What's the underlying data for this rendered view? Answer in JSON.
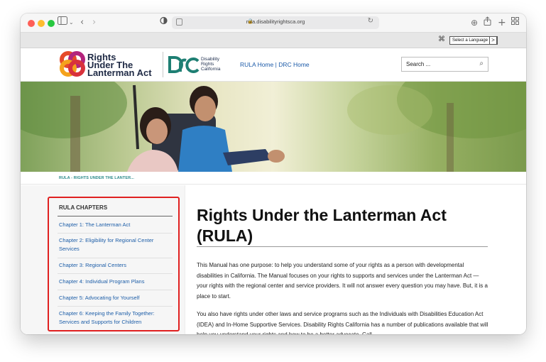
{
  "browser": {
    "url": "rula.disabilityrightsca.org"
  },
  "language": {
    "select_label": "Select a Language",
    "arrow": ">"
  },
  "header": {
    "logo_lines": [
      "Rights",
      "Under The",
      "Lanterman Act"
    ],
    "drc_lines": [
      "Disability",
      "Rights",
      "California"
    ],
    "home_link": "RULA Home",
    "separator": " | ",
    "drc_home_link": "DRC Home",
    "search_placeholder": "Search ..."
  },
  "breadcrumb": "RULA - RIGHTS UNDER THE LANTER...",
  "sidebar": {
    "title": "RULA CHAPTERS",
    "chapters": [
      "Chapter 1: The Lanterman Act",
      "Chapter 2: Eligibility for Regional Center Services",
      "Chapter 3: Regional Centers",
      "Chapter 4: Individual Program Plans",
      "Chapter 5: Advocating for Yourself",
      "Chapter 6: Keeping the Family Together: Services and Supports for Children"
    ]
  },
  "main": {
    "title": "Rights Under the Lanterman Act (RULA)",
    "paragraphs": [
      "This Manual has one purpose: to help you understand some of your rights as a person with developmental disabilities in California. The Manual focuses on your rights to supports and services under the Lanterman Act — your rights with the regional center and service providers. It will not answer every question you may have. But, it is a place to start.",
      "You also have rights under other laws and service programs such as the Individuals with Disabilities Education Act (IDEA) and In-Home Supportive Services. Disability Rights California has a number of publications available that will help you understand your rights and how to be a better advocate. Call"
    ]
  },
  "colors": {
    "link": "#1d5ea8",
    "title_navy": "#202b46",
    "drc_teal": "#1e7f73",
    "highlight_border": "#e02020",
    "breadcrumb_teal": "#2a8a8a"
  },
  "icons": [
    "sidebar-toggle-icon",
    "back-icon",
    "forward-icon",
    "shield-icon",
    "reader-icon",
    "lock-icon",
    "reload-icon",
    "download-icon",
    "share-icon",
    "new-tab-icon",
    "tab-overview-icon",
    "translate-icon",
    "search-icon"
  ]
}
